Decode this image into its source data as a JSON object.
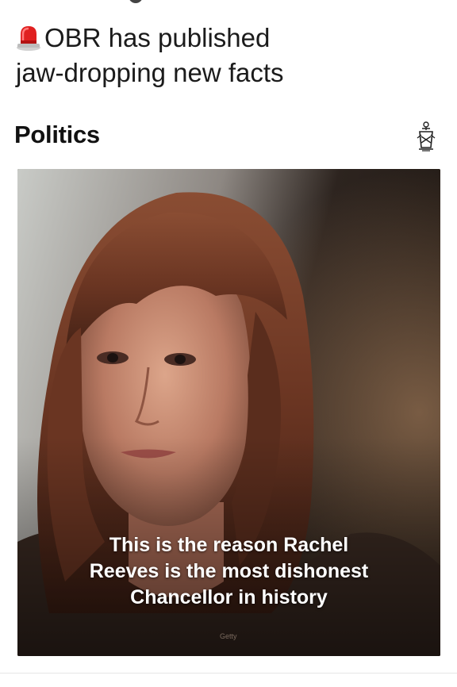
{
  "status_fragment": {
    "signal_icon": "signal-bars-icon",
    "status_icon": "circle-icon"
  },
  "article": {
    "headline_icon": "siren-emoji-icon",
    "headline_line1": "OBR has published",
    "headline_line2": "jaw-dropping new facts",
    "section": "Politics",
    "publisher_logo": "publisher-crest-icon",
    "image": {
      "caption_line1": "This is the reason Rachel",
      "caption_line2": "Reeves is the most dishonest",
      "caption_line3": "Chancellor in history",
      "credit": "Getty"
    }
  },
  "colors": {
    "siren_red": "#e02020",
    "text": "#1b1b1b",
    "image_bg": "#2a211c"
  }
}
